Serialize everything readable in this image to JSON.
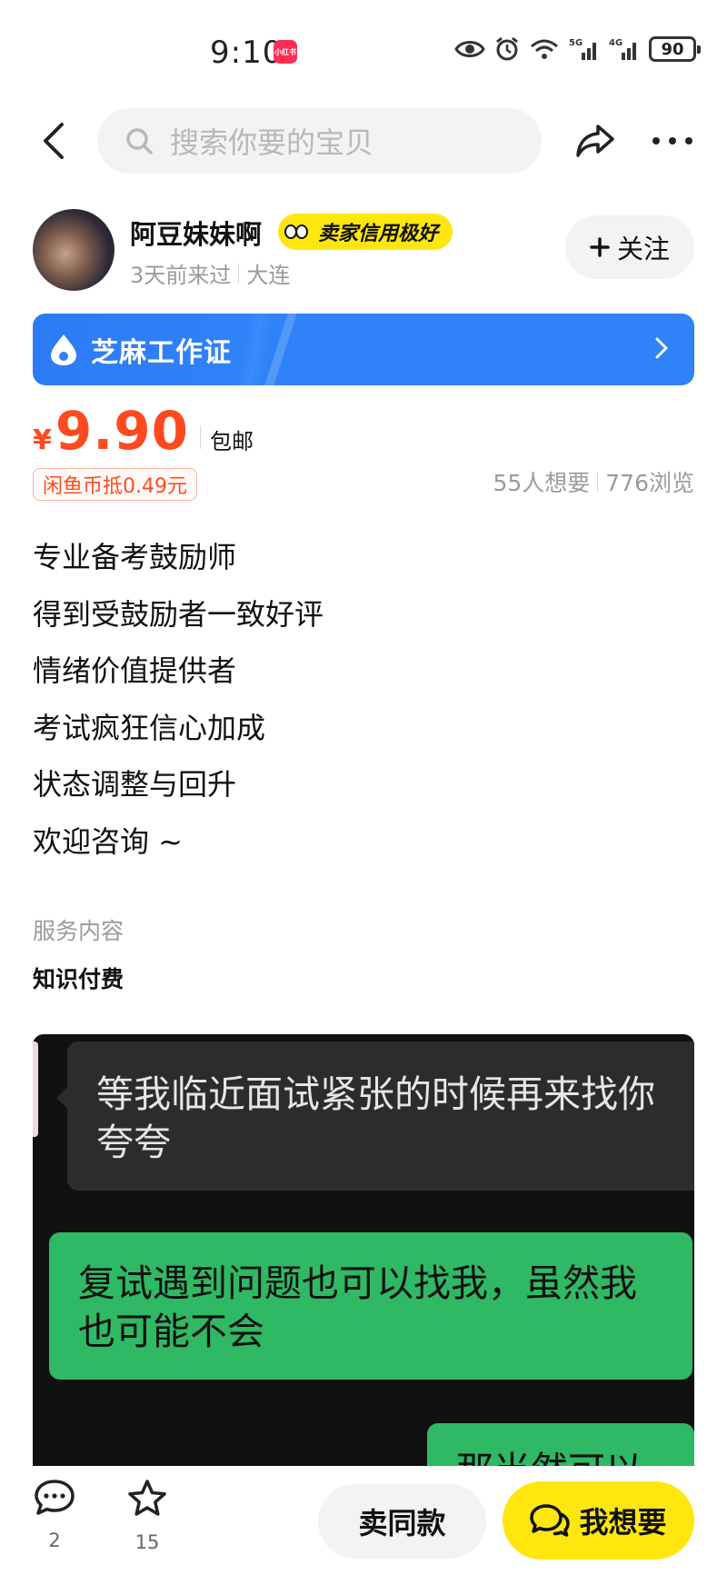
{
  "status_bar": {
    "time": "9:10",
    "app_badge": "小红书",
    "signal_label_1": "5G",
    "signal_label_2": "4G",
    "battery": "90"
  },
  "nav": {
    "search_placeholder": "搜索你要的宝贝",
    "icons": [
      "back-arrow-icon",
      "search-icon",
      "share-icon",
      "more-icon"
    ]
  },
  "seller": {
    "name": "阿豆妹妹啊",
    "credit_badge": "卖家信用极好",
    "last_seen": "3天前来过",
    "location": "大连",
    "follow_label": "关注"
  },
  "sesame": {
    "label": "芝麻工作证"
  },
  "price": {
    "currency": "¥",
    "value": "9.90",
    "shipping": "包邮",
    "coin_offset": "闲鱼币抵0.49元"
  },
  "stats": {
    "wants": "55人想要",
    "views": "776浏览"
  },
  "description": [
    "专业备考鼓励师",
    "得到受鼓励者一致好评",
    "情绪价值提供者",
    "考试疯狂信心加成",
    "状态调整与回升",
    "欢迎咨询 ~"
  ],
  "service": {
    "label": "服务内容",
    "value": "知识付费"
  },
  "chat_image": {
    "message_left": "等我临近面试紧张的时候再来找你夸夸",
    "message_right": "复试遇到问题也可以找我，虽然我也可能不会",
    "message_right_partial": "那当然可以"
  },
  "bottom_bar": {
    "comment_count": "2",
    "favorite_count": "15",
    "same_item_label": "卖同款",
    "want_label": "我想要"
  },
  "colors": {
    "price": "#ff4a1f",
    "brand_yellow": "#ffe60f",
    "sesame_blue": "#2f82f8",
    "chat_green": "#2fb964"
  }
}
